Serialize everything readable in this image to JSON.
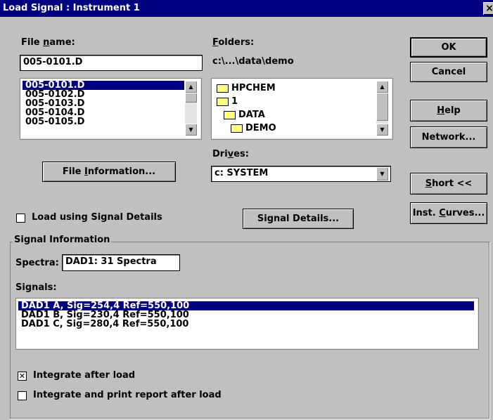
{
  "title": "Load Signal : Instrument 1",
  "file_name": {
    "label_pre": "File ",
    "label_u": "n",
    "label_post": "ame:",
    "value": "005-0101.D",
    "files": [
      "005-0101.D",
      "005-0102.D",
      "005-0103.D",
      "005-0104.D",
      "005-0105.D"
    ]
  },
  "folders": {
    "label_u": "F",
    "label_post": "olders:",
    "path": "c:\\...\\data\\demo",
    "items": [
      "HPCHEM",
      "1",
      "DATA",
      "DEMO"
    ]
  },
  "drives": {
    "label_pre": "Dri",
    "label_u": "v",
    "label_post": "es:",
    "value": "c: SYSTEM"
  },
  "buttons": {
    "ok": "OK",
    "cancel": "Cancel",
    "help_u": "H",
    "help_post": "elp",
    "network": "Network...",
    "short_u": "S",
    "short_post": "hort <<",
    "inst_pre": "Inst. ",
    "inst_u": "C",
    "inst_post": "urves...",
    "file_info_pre": "File ",
    "file_info_u": "I",
    "file_info_post": "nformation...",
    "signal_details": "Signal Details..."
  },
  "load_using_signal_details": {
    "label": "Load using Signal Details",
    "checked": false
  },
  "signal_info": {
    "group_label": "Signal Information",
    "spectra_label": "Spectra:",
    "spectra_value": "DAD1: 31 Spectra",
    "signals_label": "Signals:",
    "signals": [
      "DAD1 A, Sig=254,4 Ref=550,100",
      "DAD1 B, Sig=230,4 Ref=550,100",
      "DAD1 C, Sig=280,4 Ref=550,100"
    ]
  },
  "integrate_after_load": {
    "label": "Integrate after load",
    "checked": true,
    "mark": "✕"
  },
  "integrate_print": {
    "label": "Integrate and print report after load",
    "checked": false
  },
  "icons": {
    "close": "×",
    "up": "▲",
    "down": "▼"
  }
}
